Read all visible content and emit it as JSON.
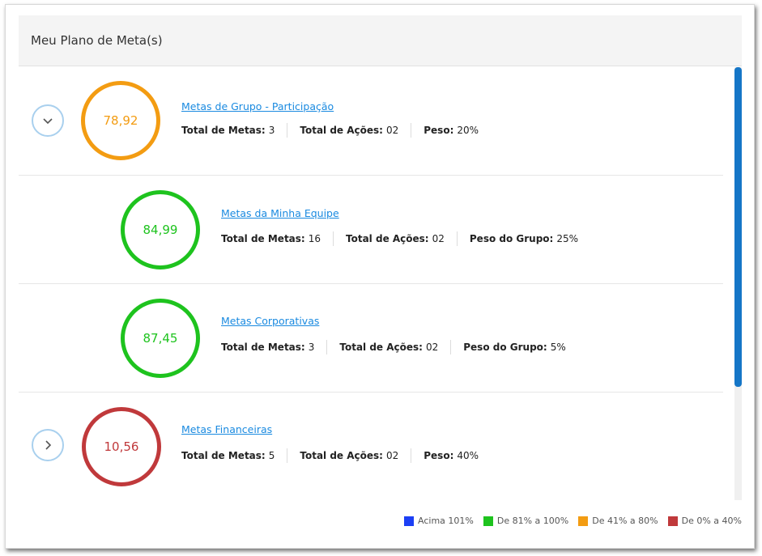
{
  "card": {
    "title": "Meu Plano de Meta(s)"
  },
  "labels": {
    "total_metas": "Total de Metas:",
    "total_acoes": "Total de Ações:",
    "peso": "Peso:",
    "peso_grupo": "Peso do Grupo:"
  },
  "rows": [
    {
      "name": "Metas de Grupo - Participação",
      "score": "78,92",
      "status": "orange",
      "toggle": "expanded",
      "total_metas": "3",
      "total_acoes": "02",
      "peso": "20%"
    },
    {
      "name": "Metas da Minha Equipe",
      "score": "84,99",
      "status": "green",
      "total_metas": "16",
      "total_acoes": "02",
      "peso_grupo": "25%"
    },
    {
      "name": "Metas Corporativas",
      "score": "87,45",
      "status": "green",
      "total_metas": "3",
      "total_acoes": "02",
      "peso_grupo": "5%"
    },
    {
      "name": "Metas Financeiras",
      "score": "10,56",
      "status": "red",
      "toggle": "collapsed",
      "total_metas": "5",
      "total_acoes": "02",
      "peso": "40%"
    }
  ],
  "legend": [
    {
      "label": "Acima 101%",
      "color": "#1c3ff5"
    },
    {
      "label": "De 81% a 100%",
      "color": "#1ec31e"
    },
    {
      "label": "De 41% a 80%",
      "color": "#f39c12"
    },
    {
      "label": "De 0% a 40%",
      "color": "#c0393b"
    }
  ],
  "colors": {
    "accent": "#1a8ae0",
    "scrollbar": "#1576c7"
  }
}
